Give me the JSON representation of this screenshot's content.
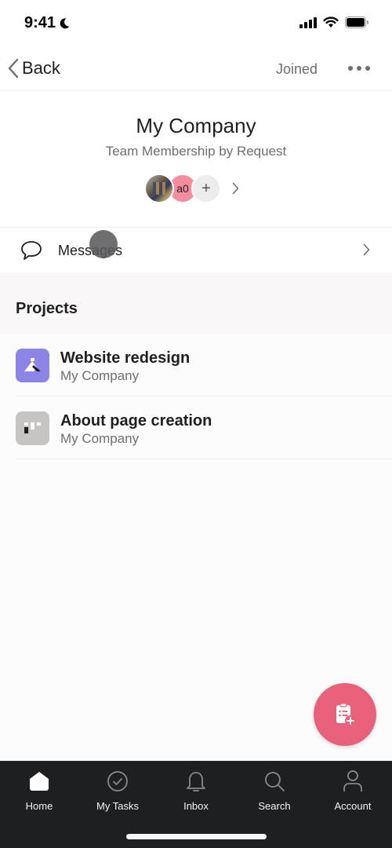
{
  "status_bar": {
    "time": "9:41",
    "icons": [
      "moon-icon",
      "cellular-signal-icon",
      "wifi-icon",
      "battery-icon"
    ]
  },
  "nav": {
    "back_label": "Back",
    "joined_label": "Joined",
    "more_icon": "more-horizontal-icon"
  },
  "team": {
    "name": "My Company",
    "subtitle": "Team Membership by Request",
    "members": [
      {
        "type": "photo"
      },
      {
        "type": "initials",
        "initials": "a0",
        "color": "#f68ca0"
      }
    ],
    "add_member_label": "+"
  },
  "messages": {
    "label": "Messages",
    "icon": "speech-bubble-icon"
  },
  "projects": {
    "title": "Projects",
    "items": [
      {
        "name": "Website redesign",
        "team": "My Company",
        "icon": "mountain-flag-icon",
        "color": "#8d84e8"
      },
      {
        "name": "About page creation",
        "team": "My Company",
        "icon": "blocks-icon",
        "color": "#c7c4c4"
      }
    ]
  },
  "fab": {
    "icon": "add-task-clipboard-icon",
    "color": "#e8607a"
  },
  "tab_bar": {
    "tabs": [
      {
        "label": "Home",
        "icon": "home-icon",
        "active": true
      },
      {
        "label": "My Tasks",
        "icon": "check-circle-icon",
        "active": false
      },
      {
        "label": "Inbox",
        "icon": "bell-icon",
        "active": false
      },
      {
        "label": "Search",
        "icon": "search-icon",
        "active": false
      },
      {
        "label": "Account",
        "icon": "person-icon",
        "active": false
      }
    ]
  }
}
